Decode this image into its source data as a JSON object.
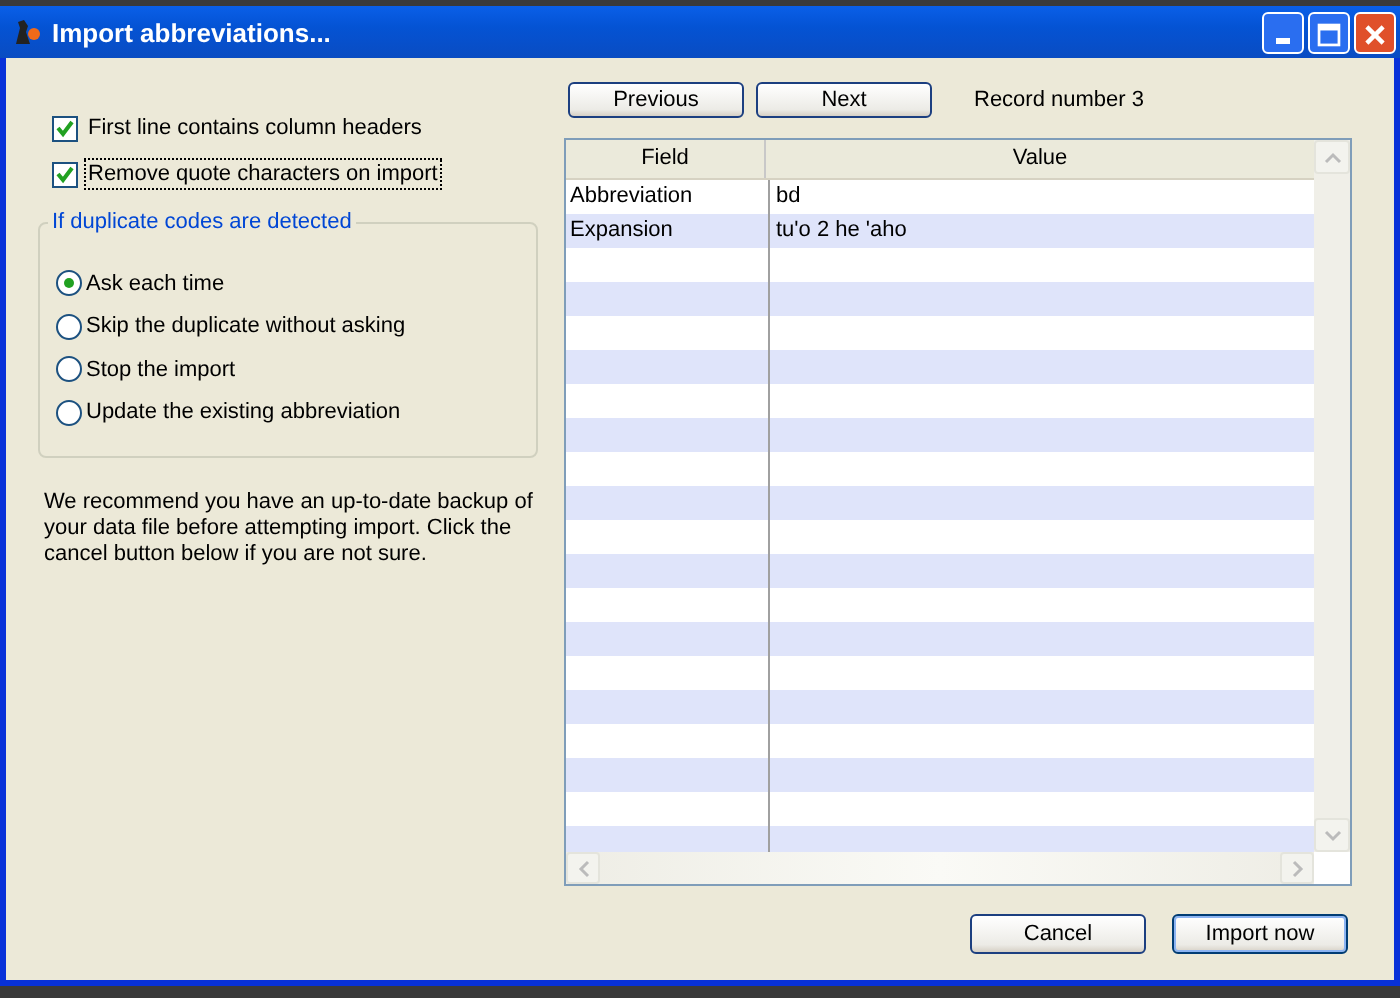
{
  "window": {
    "title": "Import abbreviations..."
  },
  "options": [
    {
      "label": "First line contains column headers",
      "checked": true,
      "focused": false
    },
    {
      "label": "Remove quote characters on import",
      "checked": true,
      "focused": true
    }
  ],
  "duplicates": {
    "legend": "If duplicate codes are detected",
    "choices": [
      {
        "label": "Ask each time",
        "selected": true
      },
      {
        "label": "Skip the duplicate without asking",
        "selected": false
      },
      {
        "label": "Stop the import",
        "selected": false
      },
      {
        "label": "Update the existing abbreviation",
        "selected": false
      }
    ]
  },
  "note": "We recommend you have an up-to-date backup of your data file before attempting import. Click the cancel button below if you are not sure.",
  "navigation": {
    "previous": "Previous",
    "next": "Next",
    "record": "Record number 3"
  },
  "table": {
    "columns": [
      "Field",
      "Value"
    ],
    "rows": [
      [
        "Abbreviation",
        "bd"
      ],
      [
        "Expansion",
        "tu'o 2 he 'aho"
      ]
    ]
  },
  "buttons": {
    "cancel": "Cancel",
    "import": "Import now"
  }
}
